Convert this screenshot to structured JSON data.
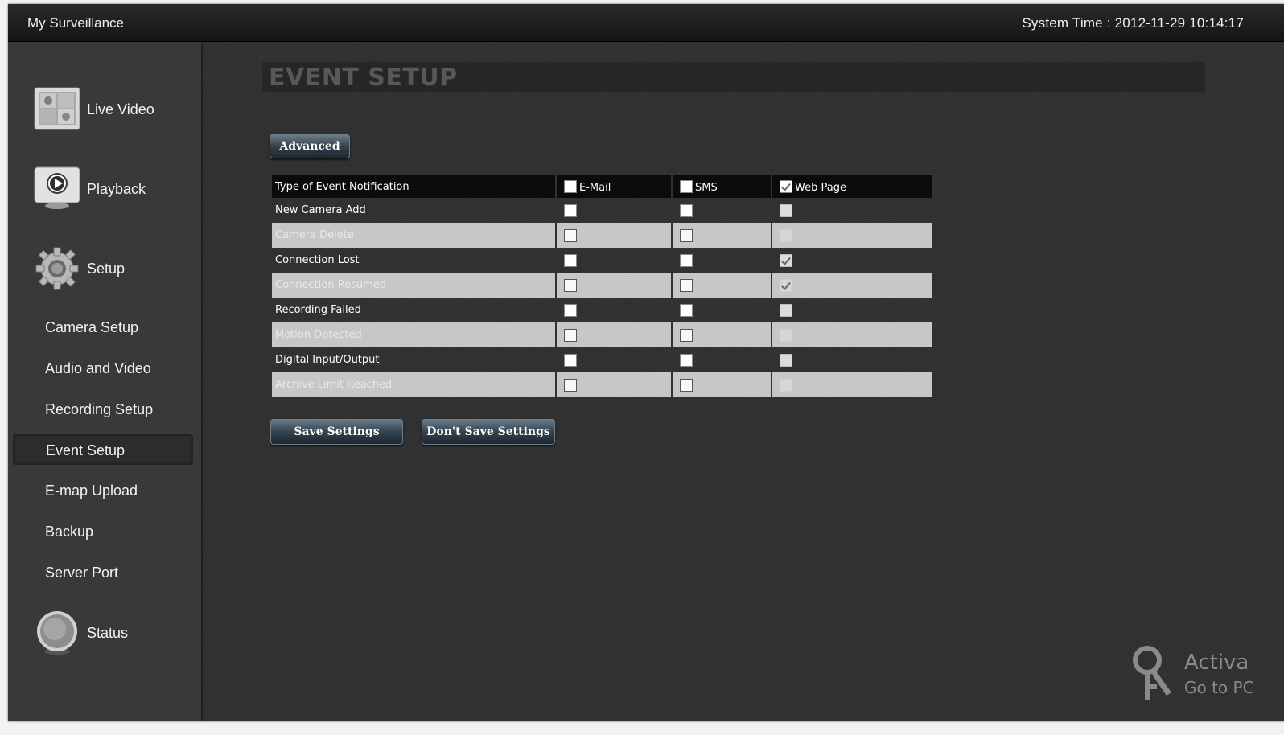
{
  "topbar": {
    "title": "My Surveillance",
    "system_time": "System Time : 2012-11-29 10:14:17"
  },
  "sidebar": {
    "main": [
      {
        "label": "Live Video",
        "icon": "live-video-icon"
      },
      {
        "label": "Playback",
        "icon": "playback-icon"
      },
      {
        "label": "Setup",
        "icon": "gear-icon"
      },
      {
        "label": "Status",
        "icon": "status-icon"
      }
    ],
    "setup_items": [
      {
        "label": "Camera Setup"
      },
      {
        "label": "Audio and Video"
      },
      {
        "label": "Recording Setup"
      },
      {
        "label": "Event Setup",
        "active": true
      },
      {
        "label": "E-map Upload"
      },
      {
        "label": "Backup"
      },
      {
        "label": "Server Port"
      }
    ]
  },
  "page": {
    "title": "EVENT SETUP",
    "advanced_label": "Advanced",
    "save_label": "Save Settings",
    "dont_save_label": "Don't Save Settings"
  },
  "table": {
    "header": {
      "type_label": "Type of Event Notification",
      "email_label": "E-Mail",
      "sms_label": "SMS",
      "web_label": "Web Page",
      "email_checked": false,
      "sms_checked": false,
      "web_checked": true
    },
    "rows": [
      {
        "name": "New Camera Add",
        "email": false,
        "sms": false,
        "web": false,
        "web_disabled": true
      },
      {
        "name": "Camera Delete",
        "email": false,
        "sms": false,
        "web": false,
        "web_disabled": true
      },
      {
        "name": "Connection Lost",
        "email": false,
        "sms": false,
        "web": true,
        "web_disabled": true
      },
      {
        "name": "Connection Resumed",
        "email": false,
        "sms": false,
        "web": true,
        "web_disabled": true
      },
      {
        "name": "Recording Failed",
        "email": false,
        "sms": false,
        "web": false,
        "web_disabled": true
      },
      {
        "name": "Motion Detected",
        "email": false,
        "sms": false,
        "web": false,
        "web_disabled": true
      },
      {
        "name": "Digital Input/Output",
        "email": false,
        "sms": false,
        "web": false,
        "web_disabled": true
      },
      {
        "name": "Archive Limit Reached",
        "email": false,
        "sms": false,
        "web": false,
        "web_disabled": true
      }
    ]
  },
  "watermark": {
    "line1": "Activa",
    "line2": "Go to PC"
  }
}
